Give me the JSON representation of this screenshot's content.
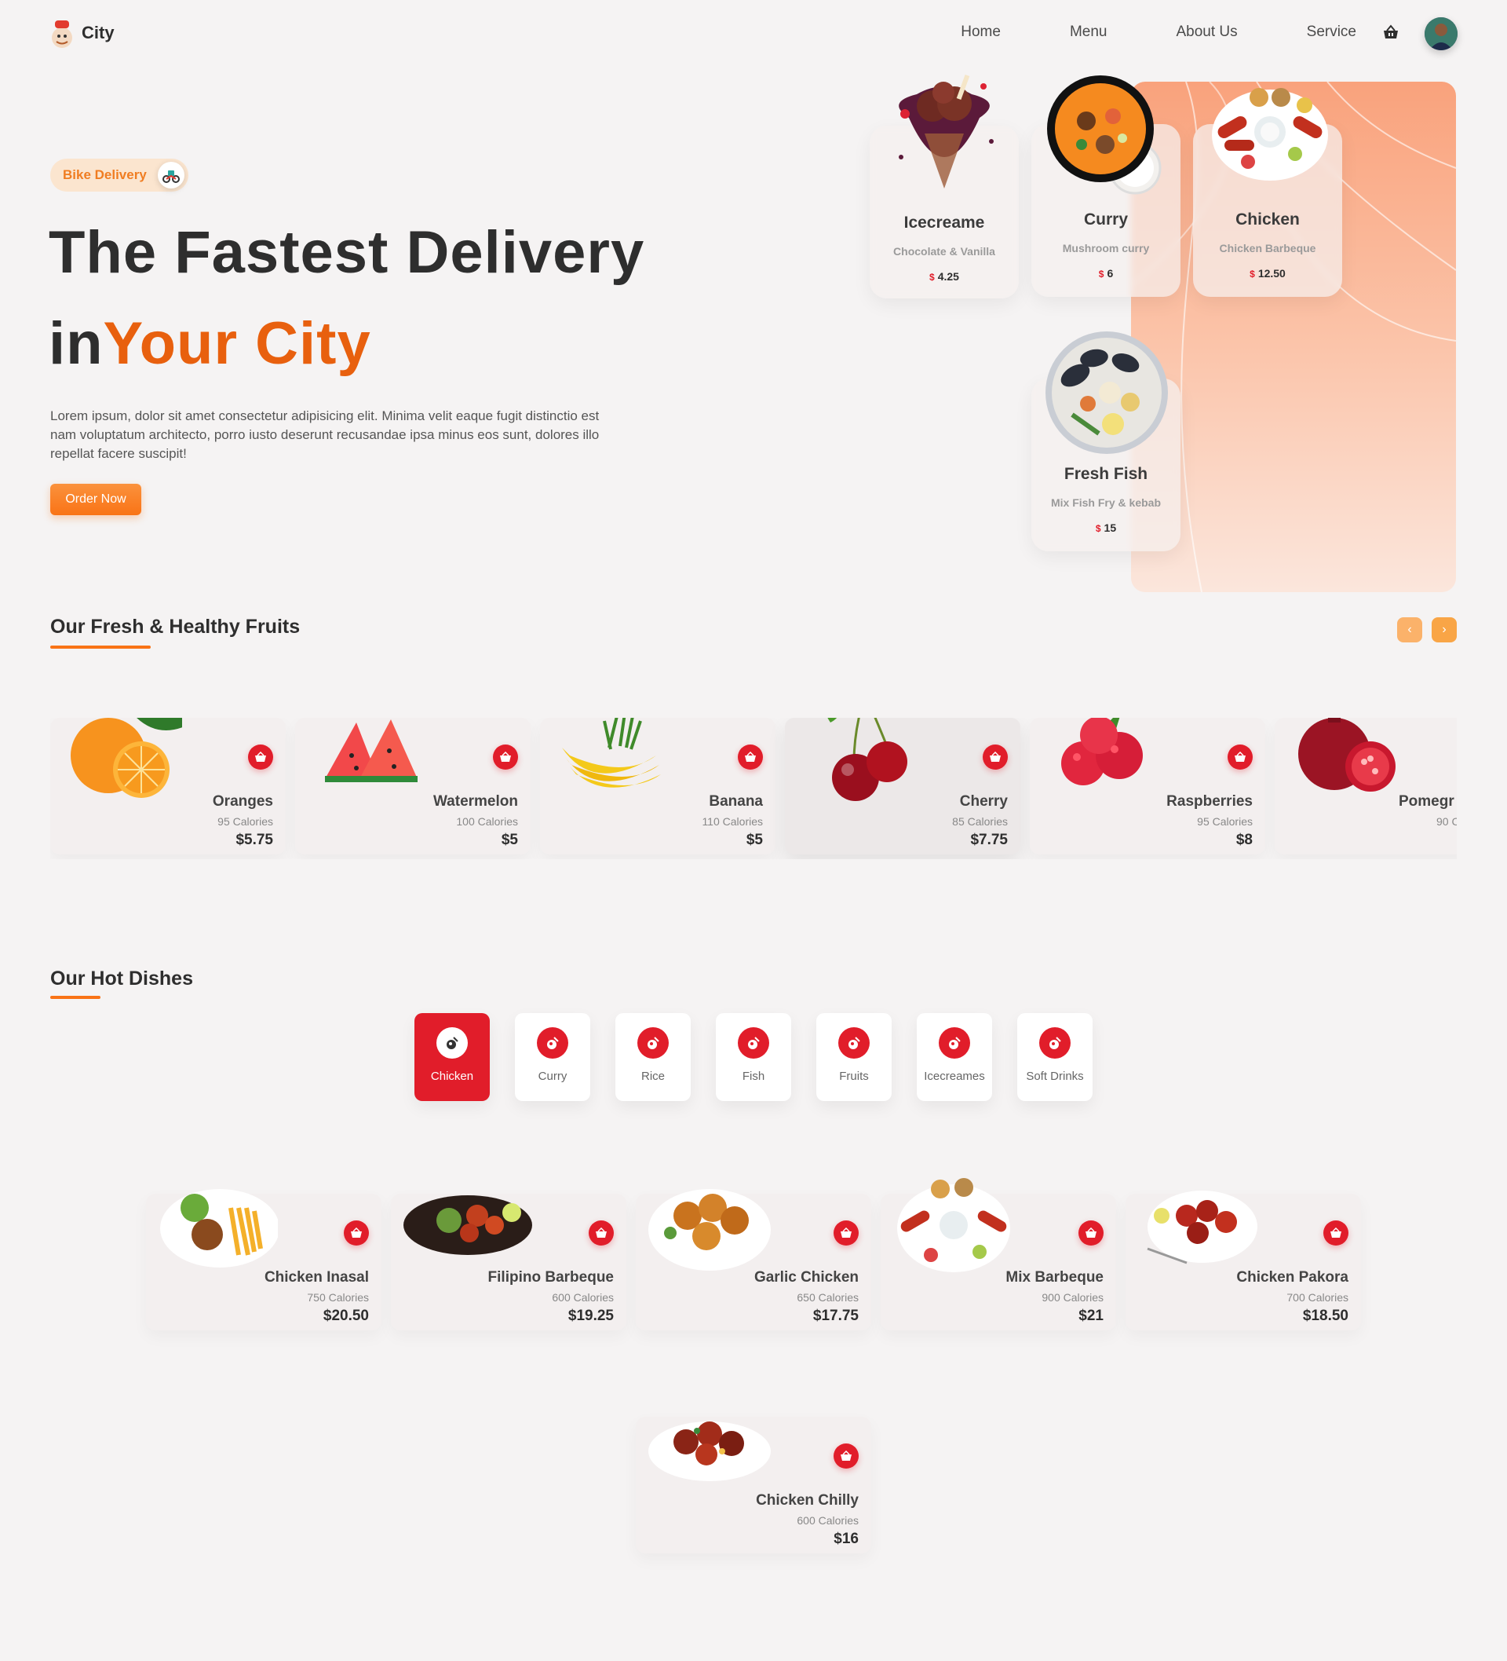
{
  "header": {
    "brand": "City",
    "nav": [
      "Home",
      "Menu",
      "About Us",
      "Service"
    ]
  },
  "hero": {
    "badge": "Bike Delivery",
    "title_line1": "The Fastest Delivery",
    "title_line2_prefix": "in",
    "title_line2_accent": "Your City",
    "description": "Lorem ipsum, dolor sit amet consectetur adipisicing elit. Minima velit eaque fugit distinctio est nam voluptatum architecto, porro iusto deserunt recusandae ipsa minus eos sunt, dolores illo repellat facere suscipit!",
    "order_button": "Order Now",
    "cards": [
      {
        "name": "Icecreame",
        "desc": "Chocolate & Vanilla",
        "currency": "$",
        "price": "4.25"
      },
      {
        "name": "Curry",
        "desc": "Mushroom curry",
        "currency": "$",
        "price": "6"
      },
      {
        "name": "Chicken",
        "desc": "Chicken Barbeque",
        "currency": "$",
        "price": "12.50"
      },
      {
        "name": "Fresh Fish",
        "desc": "Mix Fish Fry & kebab",
        "currency": "$",
        "price": "15"
      }
    ]
  },
  "fruits": {
    "title": "Our Fresh & Healthy Fruits",
    "prev": "‹",
    "next": "›",
    "items": [
      {
        "name": "Oranges",
        "calories": "95 Calories",
        "currency": "$",
        "price": "5.75"
      },
      {
        "name": "Watermelon",
        "calories": "100 Calories",
        "currency": "$",
        "price": "5"
      },
      {
        "name": "Banana",
        "calories": "110 Calories",
        "currency": "$",
        "price": "5"
      },
      {
        "name": "Cherry",
        "calories": "85 Calories",
        "currency": "$",
        "price": "7.75"
      },
      {
        "name": "Raspberries",
        "calories": "95 Calories",
        "currency": "$",
        "price": "8"
      },
      {
        "name": "Pomegr",
        "calories": "90 C",
        "currency": "",
        "price": ""
      }
    ]
  },
  "dishes": {
    "title": "Our Hot Dishes",
    "categories": [
      "Chicken",
      "Curry",
      "Rice",
      "Fish",
      "Fruits",
      "Icecreames",
      "Soft Drinks"
    ],
    "active_category": "Chicken",
    "items": [
      {
        "name": "Chicken Inasal",
        "calories": "750 Calories",
        "currency": "$",
        "price": "20.50"
      },
      {
        "name": "Filipino Barbeque",
        "calories": "600 Calories",
        "currency": "$",
        "price": "19.25"
      },
      {
        "name": "Garlic Chicken",
        "calories": "650 Calories",
        "currency": "$",
        "price": "17.75"
      },
      {
        "name": "Mix Barbeque",
        "calories": "900 Calories",
        "currency": "$",
        "price": "21"
      },
      {
        "name": "Chicken Pakora",
        "calories": "700 Calories",
        "currency": "$",
        "price": "18.50"
      },
      {
        "name": "Chicken Chilly",
        "calories": "600 Calories",
        "currency": "$",
        "price": "16"
      }
    ]
  },
  "colors": {
    "accent_orange": "#e8600e",
    "button_orange": "#f97316",
    "cart_red": "#e11d2a",
    "panel_peach": "#f9a27c"
  }
}
